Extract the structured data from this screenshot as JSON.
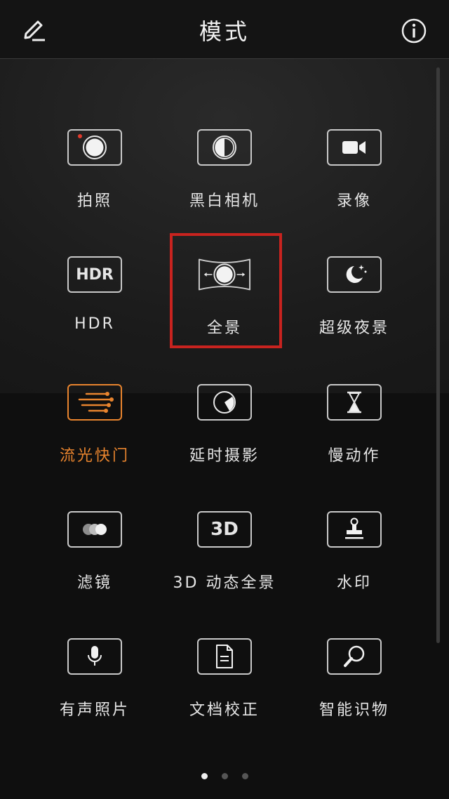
{
  "header": {
    "title": "模式",
    "edit_icon": "pencil-icon",
    "info_icon": "info-icon"
  },
  "modes": [
    {
      "label": "拍照",
      "icon": "camera-shutter-icon"
    },
    {
      "label": "黑白相机",
      "icon": "monochrome-icon"
    },
    {
      "label": "录像",
      "icon": "video-camera-icon"
    },
    {
      "label": "HDR",
      "icon": "hdr-icon",
      "icon_text": "HDR"
    },
    {
      "label": "全景",
      "icon": "panorama-icon"
    },
    {
      "label": "超级夜景",
      "icon": "night-moon-icon"
    },
    {
      "label": "流光快门",
      "icon": "light-trails-icon"
    },
    {
      "label": "延时摄影",
      "icon": "timelapse-icon"
    },
    {
      "label": "慢动作",
      "icon": "hourglass-icon"
    },
    {
      "label": "滤镜",
      "icon": "filter-icon"
    },
    {
      "label": "3D 动态全景",
      "icon": "3d-icon",
      "icon_text": "3D"
    },
    {
      "label": "水印",
      "icon": "watermark-stamp-icon"
    },
    {
      "label": "有声照片",
      "icon": "microphone-icon"
    },
    {
      "label": "文档校正",
      "icon": "document-icon"
    },
    {
      "label": "智能识物",
      "icon": "magnifier-icon"
    }
  ],
  "active_mode": "流光快门",
  "highlighted_mode": "全景",
  "colors": {
    "accent": "#e8842e",
    "highlight_border": "#c8231f",
    "background": "#141414"
  },
  "pagination": {
    "pages": 3,
    "current": 1
  }
}
